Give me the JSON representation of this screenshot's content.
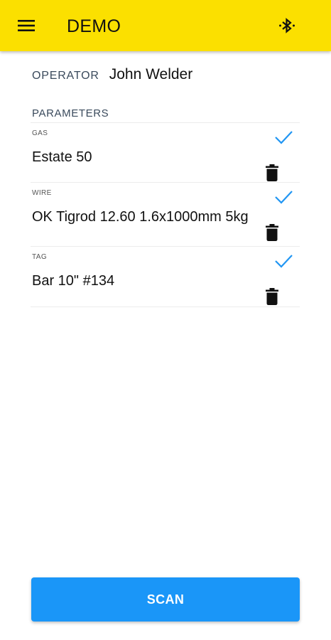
{
  "appbar": {
    "title": "DEMO",
    "menu_icon": "hamburger-menu-icon",
    "bluetooth_icon": "bluetooth-icon",
    "background_color": "#fbe000"
  },
  "operator": {
    "label": "OPERATOR",
    "value": "John Welder"
  },
  "parameters": {
    "header": "PARAMETERS",
    "items": [
      {
        "label": "GAS",
        "value": "Estate 50",
        "status_icon": "check-icon",
        "delete_icon": "trash-icon"
      },
      {
        "label": "WIRE",
        "value": "OK Tigrod 12.60 1.6x1000mm 5kg",
        "status_icon": "check-icon",
        "delete_icon": "trash-icon"
      },
      {
        "label": "TAG",
        "value": "Bar 10\" #134",
        "status_icon": "check-icon",
        "delete_icon": "trash-icon"
      }
    ]
  },
  "scan_button": {
    "label": "SCAN",
    "color": "#1a96f8"
  },
  "colors": {
    "accent_check": "#2196f3",
    "label_text": "#3a4a5c"
  }
}
